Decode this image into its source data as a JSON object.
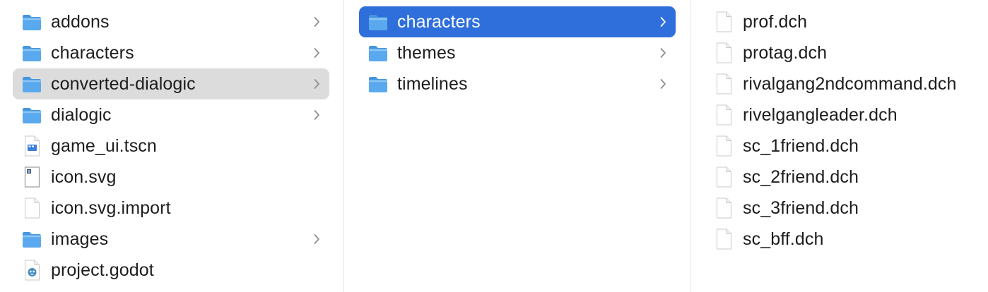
{
  "colors": {
    "selection_active": "#2f6fdb",
    "selection_inactive": "#dcdcdc",
    "folder_blue": "#5aa9ee",
    "text": "#1d1d1f",
    "chevron": "#8e8e93"
  },
  "columns": [
    {
      "items": [
        {
          "name": "addons",
          "kind": "folder",
          "icon": "folder-icon",
          "has_children": true,
          "selected": false
        },
        {
          "name": "characters",
          "kind": "folder",
          "icon": "folder-icon",
          "has_children": true,
          "selected": false
        },
        {
          "name": "converted-dialogic",
          "kind": "folder",
          "icon": "folder-icon",
          "has_children": true,
          "selected": "inactive"
        },
        {
          "name": "dialogic",
          "kind": "folder",
          "icon": "folder-icon",
          "has_children": true,
          "selected": false
        },
        {
          "name": "game_ui.tscn",
          "kind": "file",
          "icon": "scene-file-icon",
          "has_children": false,
          "selected": false
        },
        {
          "name": "icon.svg",
          "kind": "file",
          "icon": "svg-file-icon",
          "has_children": false,
          "selected": false
        },
        {
          "name": "icon.svg.import",
          "kind": "file",
          "icon": "blank-file-icon",
          "has_children": false,
          "selected": false
        },
        {
          "name": "images",
          "kind": "folder",
          "icon": "folder-icon",
          "has_children": true,
          "selected": false
        },
        {
          "name": "project.godot",
          "kind": "file",
          "icon": "godot-file-icon",
          "has_children": false,
          "selected": false
        }
      ]
    },
    {
      "items": [
        {
          "name": "characters",
          "kind": "folder",
          "icon": "folder-icon",
          "has_children": true,
          "selected": "active"
        },
        {
          "name": "themes",
          "kind": "folder",
          "icon": "folder-icon",
          "has_children": true,
          "selected": false
        },
        {
          "name": "timelines",
          "kind": "folder",
          "icon": "folder-icon",
          "has_children": true,
          "selected": false
        }
      ]
    },
    {
      "items": [
        {
          "name": "prof.dch",
          "kind": "file",
          "icon": "blank-file-icon",
          "has_children": false,
          "selected": false
        },
        {
          "name": "protag.dch",
          "kind": "file",
          "icon": "blank-file-icon",
          "has_children": false,
          "selected": false
        },
        {
          "name": "rivalgang2ndcommand.dch",
          "kind": "file",
          "icon": "blank-file-icon",
          "has_children": false,
          "selected": false
        },
        {
          "name": "rivelgangleader.dch",
          "kind": "file",
          "icon": "blank-file-icon",
          "has_children": false,
          "selected": false
        },
        {
          "name": "sc_1friend.dch",
          "kind": "file",
          "icon": "blank-file-icon",
          "has_children": false,
          "selected": false
        },
        {
          "name": "sc_2friend.dch",
          "kind": "file",
          "icon": "blank-file-icon",
          "has_children": false,
          "selected": false
        },
        {
          "name": "sc_3friend.dch",
          "kind": "file",
          "icon": "blank-file-icon",
          "has_children": false,
          "selected": false
        },
        {
          "name": "sc_bff.dch",
          "kind": "file",
          "icon": "blank-file-icon",
          "has_children": false,
          "selected": false
        }
      ]
    }
  ]
}
